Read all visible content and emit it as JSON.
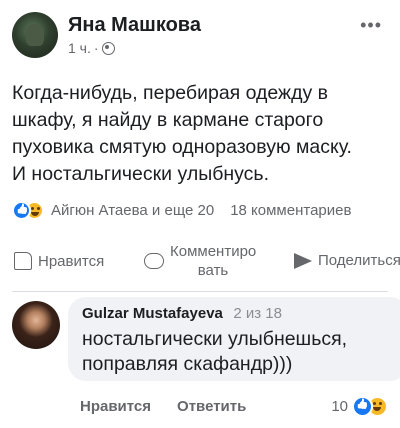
{
  "post": {
    "author": "Яна Машкова",
    "time": "1 ч.",
    "dot": "·",
    "text": "Когда-нибудь, перебирая одежду в\nшкафу, я найду в кармане старого\nпуховика смятую одноразовую маску.\nИ ностальгически улыбнусь."
  },
  "reactions": {
    "names": "Айгюн Атаева и еще 20",
    "comments_count": "18 комментариев",
    "icons": [
      "like-react-icon",
      "haha-react-icon"
    ]
  },
  "actions": {
    "like": "Нравится",
    "comment": "Комментиро\nвать",
    "share": "Поделиться"
  },
  "comment": {
    "author": "Gulzar Mustafayeva",
    "page": "2 из 18",
    "text": "ностальгически улыбнешься,\nпоправляя скафандр)))",
    "like_label": "Нравится",
    "reply_label": "Ответить",
    "reactions_count": "10"
  },
  "colors": {
    "like_blue": "#1877f2",
    "haha_yellow": "#f7b928",
    "muted_text": "#65676b",
    "bubble_bg": "#f0f2f5"
  }
}
